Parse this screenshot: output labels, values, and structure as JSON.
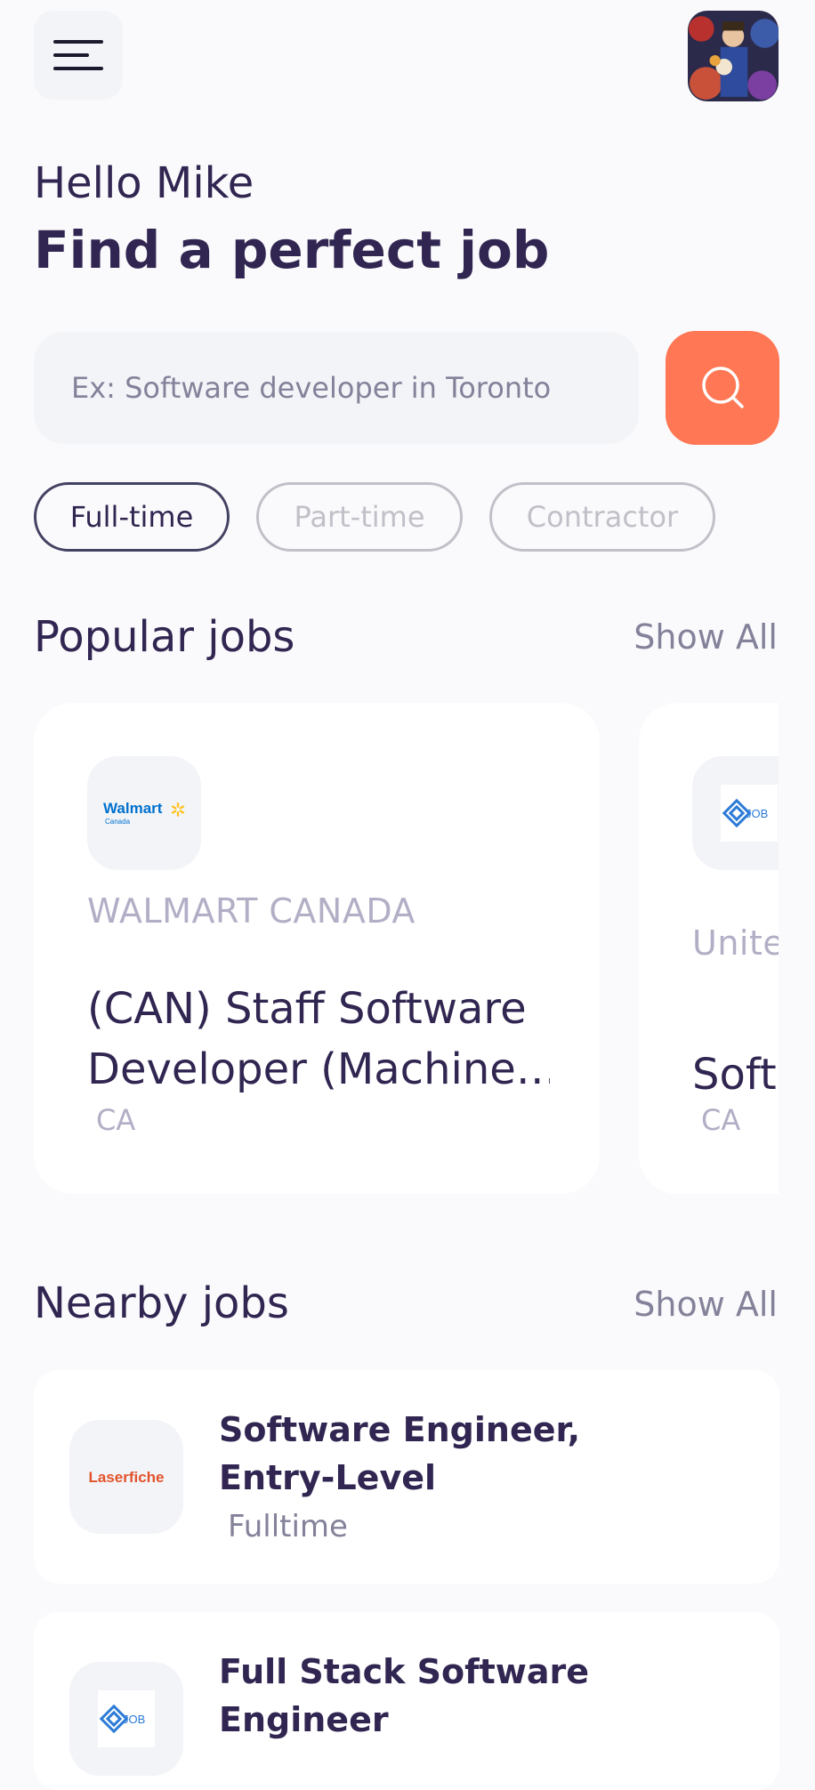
{
  "header": {
    "menu_icon": "menu-icon",
    "avatar_label": "user-avatar"
  },
  "greeting": {
    "hello": "Hello Mike",
    "title": "Find a perfect job"
  },
  "search": {
    "placeholder": "Ex: Software developer in Toronto",
    "button_icon": "search-icon"
  },
  "job_types": [
    {
      "label": "Full-time",
      "active": true
    },
    {
      "label": "Part-time",
      "active": false
    },
    {
      "label": "Contractor",
      "active": false
    }
  ],
  "popular": {
    "title": "Popular jobs",
    "show_all": "Show All",
    "cards": [
      {
        "logo_text": "Walmart",
        "logo_subtext": "Canada",
        "company": "WALMART CANADA",
        "title": "(CAN) Staff Software Developer (Machine…",
        "title_line1": "(CAN) Staff Software",
        "title_line2": "Developer (Machine…",
        "location": "CA"
      },
      {
        "logo_text": "JOB",
        "company": "Unite",
        "title": "Soft",
        "location": "CA"
      }
    ]
  },
  "nearby": {
    "title": "Nearby jobs",
    "show_all": "Show All",
    "items": [
      {
        "logo_text": "Laserfiche",
        "title_line1": "Software Engineer,",
        "title_line2": "Entry-Level",
        "type": "Fulltime"
      },
      {
        "logo_text": "JOB",
        "title_line1": "Full Stack Software",
        "title_line2": "Engineer",
        "type": ""
      }
    ]
  },
  "colors": {
    "primary": "#312651",
    "accent": "#FF7754",
    "gray": "#83829A",
    "light_gray": "#C1C0C8",
    "background": "#FAFAFC",
    "walmart_blue": "#0071CE",
    "walmart_yellow": "#FFC220",
    "laserfiche_orange": "#E2532B"
  }
}
